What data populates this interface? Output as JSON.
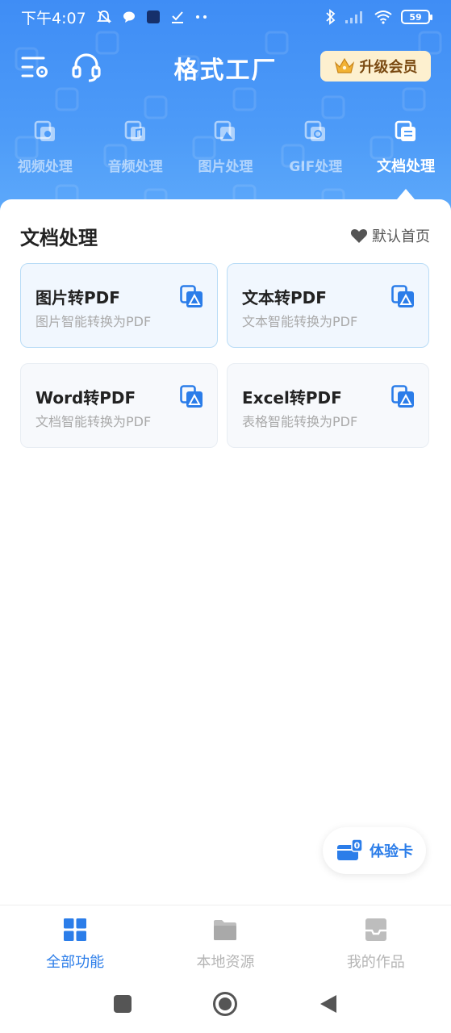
{
  "status_bar": {
    "time": "下午4:07",
    "battery": "59"
  },
  "app_bar": {
    "title": "格式工厂",
    "vip_label": "升级会员"
  },
  "tabs": [
    {
      "label": "视频处理",
      "icon": "video-file-icon",
      "active": false
    },
    {
      "label": "音频处理",
      "icon": "audio-file-icon",
      "active": false
    },
    {
      "label": "图片处理",
      "icon": "image-file-icon",
      "active": false
    },
    {
      "label": "GIF处理",
      "icon": "gif-file-icon",
      "active": false
    },
    {
      "label": "文档处理",
      "icon": "document-file-icon",
      "active": true
    }
  ],
  "section": {
    "title": "文档处理",
    "default_home_label": "默认首页"
  },
  "cards": [
    {
      "title": "图片转PDF",
      "subtitle": "图片智能转换为PDF"
    },
    {
      "title": "文本转PDF",
      "subtitle": "文本智能转换为PDF"
    },
    {
      "title": "Word转PDF",
      "subtitle": "文档智能转换为PDF"
    },
    {
      "title": "Excel转PDF",
      "subtitle": "表格智能转换为PDF"
    }
  ],
  "trial_card": {
    "label": "体验卡",
    "count": "0"
  },
  "bottom_nav": [
    {
      "label": "全部功能",
      "active": true
    },
    {
      "label": "本地资源",
      "active": false
    },
    {
      "label": "我的作品",
      "active": false
    }
  ],
  "colors": {
    "header_blue": "#4d9bf8",
    "accent_blue": "#2b7de9",
    "vip_bg": "#fdf0cf",
    "vip_text": "#7a4a12"
  }
}
